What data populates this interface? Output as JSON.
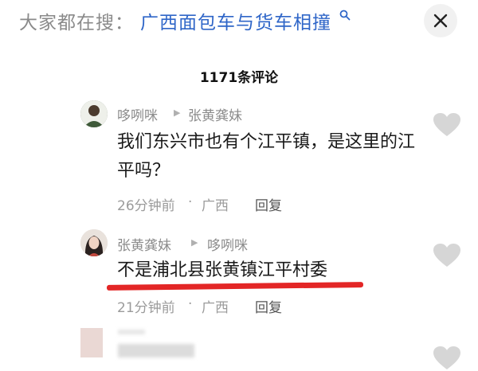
{
  "search": {
    "prefix": "大家都在搜：",
    "query": "广西面包车与货车相撞"
  },
  "comments_header": {
    "count_label": "1171条评论"
  },
  "comments": [
    {
      "author": "哆咧咪",
      "reply_to": "张黄龚妹",
      "text": "我们东兴市也有个江平镇，是这里的江平吗？",
      "time": "26分钟前",
      "location": "广西",
      "reply_label": "回复"
    },
    {
      "author": "张黄龚妹",
      "reply_to": "哆咧咪",
      "text": "不是浦北县张黄镇江平村委",
      "time": "21分钟前",
      "location": "广西",
      "reply_label": "回复"
    }
  ],
  "icons": {
    "search": "search-icon",
    "close": "close-icon",
    "reply_arrow": "triangle-right-icon",
    "like": "heart-icon"
  },
  "colors": {
    "query": "#2f66c8",
    "highlight_underline": "#e32626",
    "heart": "#d6d6d6"
  }
}
